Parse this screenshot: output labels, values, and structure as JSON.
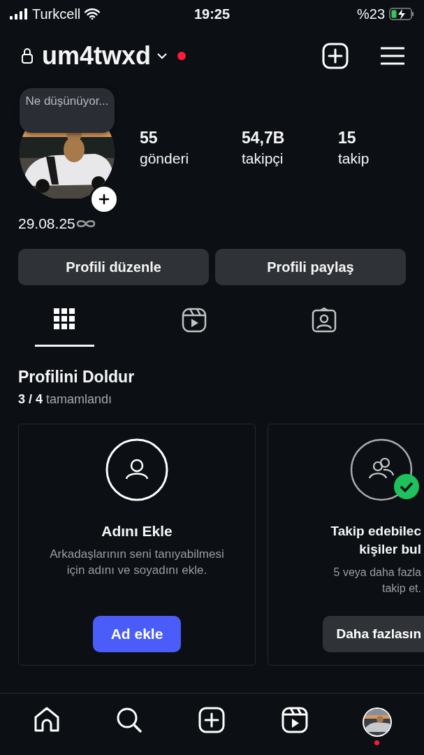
{
  "status_bar": {
    "carrier": "Turkcell",
    "time": "19:25",
    "battery": "%23"
  },
  "header": {
    "username": "um4twxd",
    "notification_dot": true
  },
  "profile": {
    "note": "Ne düşünüyor...",
    "bio": "29.08.25"
  },
  "stats": [
    {
      "value": "55",
      "label": "gönderi"
    },
    {
      "value": "54,7B",
      "label": "takipçi"
    },
    {
      "value": "15",
      "label": "takip"
    }
  ],
  "buttons": [
    "Profili düzenle",
    "Profili paylaş"
  ],
  "tabs": [
    {
      "kind": "grid",
      "selected": true
    },
    {
      "kind": "reels",
      "selected": false
    },
    {
      "kind": "tagged",
      "selected": false
    }
  ],
  "section": {
    "title": "Profilini Doldur",
    "progress": "3 / 4",
    "progress_label": "tamamlandı"
  },
  "cards": [
    {
      "kind": "person",
      "done": false,
      "title": "Adını Ekle",
      "text": "Arkadaşlarının seni tanıyabilmesi",
      "text_2": "için adını ve soyadını ekle.",
      "button": "Ad ekle"
    },
    {
      "kind": "people",
      "done": true,
      "title": "Takip edebilec",
      "title_2": "kişiler bul",
      "text": "5 veya daha fazla",
      "text_2": "takip et.",
      "button": "Daha fazlasın"
    }
  ],
  "nav": [
    {
      "kind": "home",
      "selected": false
    },
    {
      "kind": "search",
      "selected": false
    },
    {
      "kind": "create",
      "selected": false
    },
    {
      "kind": "reels",
      "selected": false
    },
    {
      "kind": "profile",
      "selected": true
    }
  ]
}
